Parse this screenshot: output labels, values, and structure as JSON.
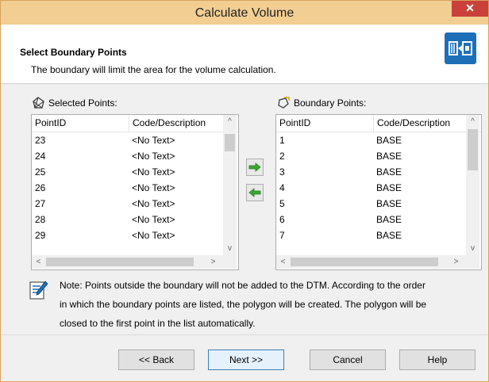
{
  "window": {
    "title": "Calculate Volume",
    "close_glyph": "✕"
  },
  "header": {
    "step_title": "Select Boundary Points",
    "step_desc": "The boundary will limit the area for the volume calculation.",
    "icon": "volume-wizard-icon",
    "icon_color": "#1d6fb8"
  },
  "selected": {
    "label": "Selected Points:",
    "icon": "points-icon",
    "columns": [
      "PointID",
      "Code/Description"
    ],
    "rows": [
      {
        "id": "23",
        "code": "<No Text>"
      },
      {
        "id": "24",
        "code": "<No Text>"
      },
      {
        "id": "25",
        "code": "<No Text>"
      },
      {
        "id": "26",
        "code": "<No Text>"
      },
      {
        "id": "27",
        "code": "<No Text>"
      },
      {
        "id": "28",
        "code": "<No Text>"
      },
      {
        "id": "29",
        "code": "<No Text>"
      }
    ]
  },
  "boundary": {
    "label": "Boundary Points:",
    "icon": "boundary-icon",
    "columns": [
      "PointID",
      "Code/Description"
    ],
    "rows": [
      {
        "id": "1",
        "code": "BASE"
      },
      {
        "id": "2",
        "code": "BASE"
      },
      {
        "id": "3",
        "code": "BASE"
      },
      {
        "id": "4",
        "code": "BASE"
      },
      {
        "id": "5",
        "code": "BASE"
      },
      {
        "id": "6",
        "code": "BASE"
      },
      {
        "id": "7",
        "code": "BASE"
      }
    ]
  },
  "move": {
    "add_icon": "arrow-right-icon",
    "remove_icon": "arrow-left-icon",
    "arrow_color": "#3aa830"
  },
  "scroll": {
    "up": "^",
    "down": "v",
    "left": "<",
    "right": ">"
  },
  "note": {
    "icon": "note-icon",
    "line1": "Note: Points outside the boundary will not be added to the DTM. According to the order",
    "line2": "in which the boundary points are listed, the polygon will be created. The polygon will be",
    "line3": "closed to the first point in the list automatically."
  },
  "buttons": {
    "back": "<< Back",
    "next": "Next >>",
    "cancel": "Cancel",
    "help": "Help"
  }
}
